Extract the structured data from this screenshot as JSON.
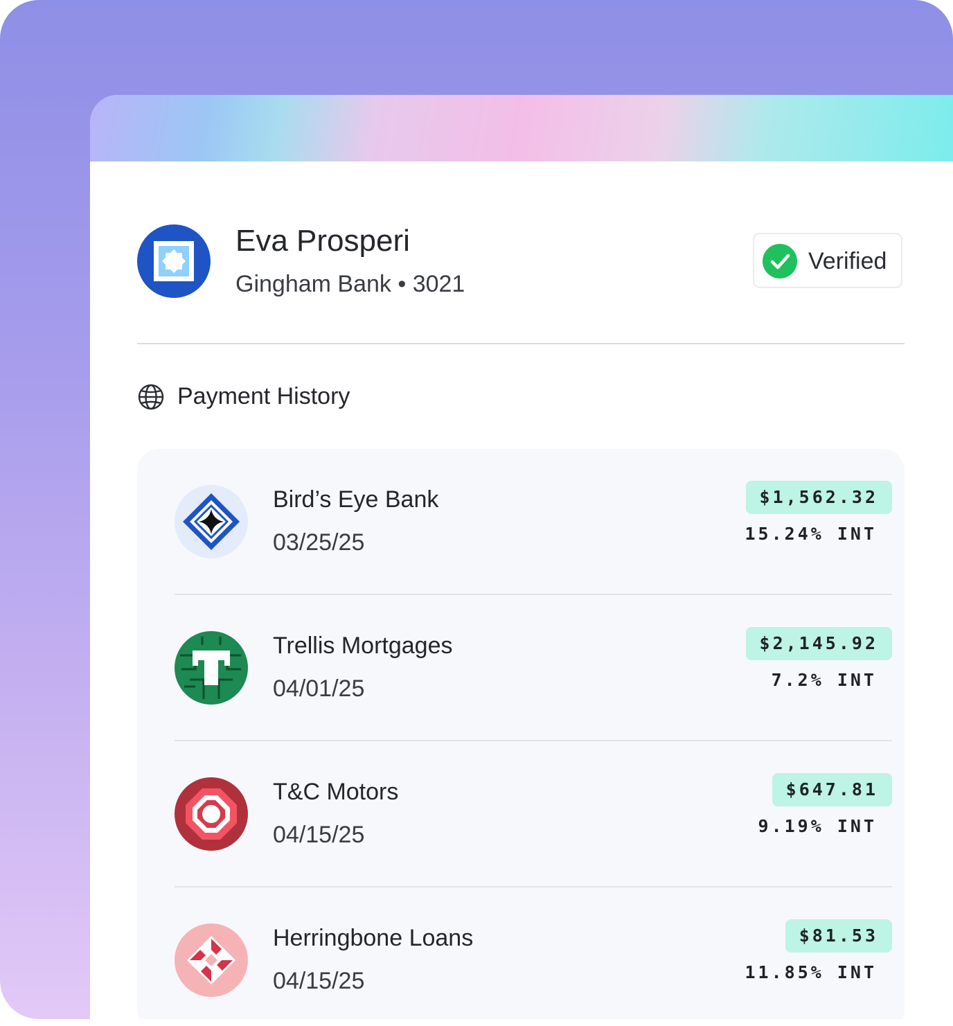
{
  "profile": {
    "name": "Eva Prosperi",
    "bank_line": "Gingham Bank • 3021",
    "status": "Verified",
    "avatar_icon": "gingham-bank-logo-icon"
  },
  "section": {
    "title": "Payment History",
    "icon": "globe-icon"
  },
  "payments": [
    {
      "lender": "Bird’s Eye Bank",
      "date": "03/25/25",
      "amount": "$1,562.32",
      "rate": "15.24% INT",
      "icon": "birds-eye-bank-logo-icon"
    },
    {
      "lender": "Trellis Mortgages",
      "date": "04/01/25",
      "amount": "$2,145.92",
      "rate": "7.2% INT",
      "icon": "trellis-mortgages-logo-icon"
    },
    {
      "lender": "T&C Motors",
      "date": "04/15/25",
      "amount": "$647.81",
      "rate": "9.19% INT",
      "icon": "tc-motors-logo-icon"
    },
    {
      "lender": "Herringbone Loans",
      "date": "04/15/25",
      "amount": "$81.53",
      "rate": "11.85% INT",
      "icon": "herringbone-loans-logo-icon"
    }
  ],
  "colors": {
    "frame_gradient_top": "#8e8fe6",
    "frame_gradient_bottom": "#e2c9f7",
    "amount_badge": "#bdf4e3",
    "verified_check": "#1fc15c",
    "gingham_blue": "#1f54c5",
    "trellis_green": "#1c8a52",
    "tc_red": "#b0313c",
    "herringbone_pink": "#f6b3b5"
  }
}
